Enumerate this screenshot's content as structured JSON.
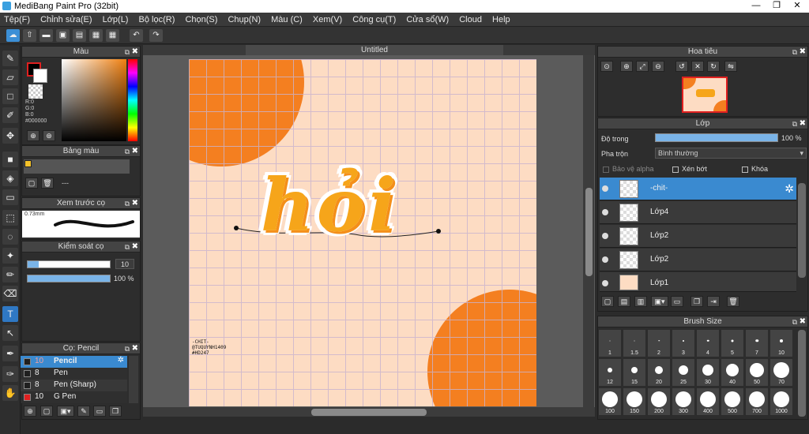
{
  "app": {
    "title": "MediBang Paint Pro (32bit)",
    "win_min": "—",
    "win_max": "❐",
    "win_close": "✕"
  },
  "menu": [
    "Tệp(F)",
    "Chỉnh sửa(E)",
    "Lớp(L)",
    "Bộ lọc(R)",
    "Chọn(S)",
    "Chụp(N)",
    "Màu (C)",
    "Xem(V)",
    "Công cụ(T)",
    "Cửa sổ(W)",
    "Cloud",
    "Help"
  ],
  "document": {
    "tab_title": "Untitled",
    "lettering": "hỏi",
    "signature_lines": [
      "-CHIT-",
      "@TUQUYNH1409",
      "#HD247"
    ]
  },
  "color_panel": {
    "title": "Màu",
    "r": "R:0",
    "g": "G:0",
    "b": "B:0",
    "hex": "#000000",
    "fg_color": "#000000",
    "bg_color": "#ffffff"
  },
  "palette_panel": {
    "title": "Bảng màu",
    "dash": "---",
    "swatch_color": "#f3c12a"
  },
  "brush_preview_panel": {
    "title": "Xem trước cọ",
    "size_label": "0.73mm"
  },
  "brush_control_panel": {
    "title": "Kiểm soát cọ",
    "size_value": "10",
    "opacity_value": "100 %"
  },
  "brush_list_panel": {
    "title": "Cọ: Pencil",
    "items": [
      {
        "size": "10",
        "name": "Pencil",
        "color": "#1f1f1f",
        "selected": true
      },
      {
        "size": "8",
        "name": "Pen",
        "color": "#1f1f1f",
        "selected": false
      },
      {
        "size": "8",
        "name": "Pen (Sharp)",
        "color": "#1f1f1f",
        "selected": false
      },
      {
        "size": "10",
        "name": "G Pen",
        "color": "#e02020",
        "selected": false
      }
    ]
  },
  "navigator_panel": {
    "title": "Hoa tiêu"
  },
  "layer_panel": {
    "title": "Lớp",
    "opacity_label": "Độ trong",
    "opacity_value": "100 %",
    "blend_label": "Pha trộn",
    "blend_value": "Bình thường",
    "protect_alpha": "Bảo vệ alpha",
    "clipping": "Xén bớt",
    "lock": "Khóa",
    "layers": [
      {
        "name": "-chit-",
        "selected": true
      },
      {
        "name": "Lớp4",
        "selected": false
      },
      {
        "name": "Lớp2",
        "selected": false
      },
      {
        "name": "Lớp2",
        "selected": false
      },
      {
        "name": "Lớp1",
        "selected": false
      }
    ]
  },
  "brush_size_panel": {
    "title": "Brush Size",
    "sizes": [
      "1",
      "1.5",
      "2",
      "3",
      "4",
      "5",
      "7",
      "10",
      "12",
      "15",
      "20",
      "25",
      "30",
      "40",
      "50",
      "70",
      "100",
      "150",
      "200",
      "300",
      "400",
      "500",
      "700",
      "1000"
    ]
  },
  "colors": {
    "accent": "#3a8ad0",
    "canvas_bg": "#fddcc3",
    "orange": "#f47f20"
  }
}
